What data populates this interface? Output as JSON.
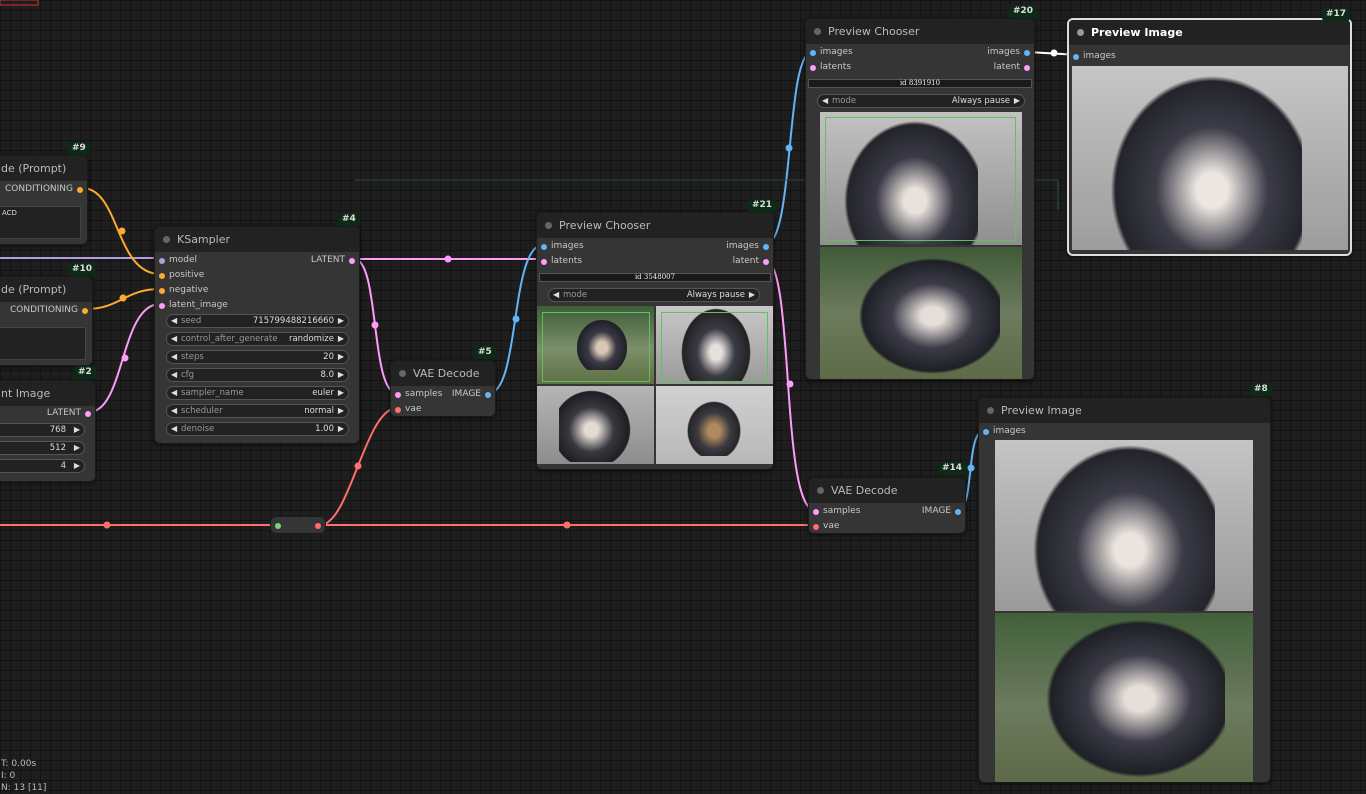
{
  "nodes": {
    "clip_pos": {
      "title": "de (Prompt)",
      "badge": "#9",
      "output": "CONDITIONING",
      "text": "ACD"
    },
    "clip_neg": {
      "title": "de (Prompt)",
      "badge": "#10",
      "output": "CONDITIONING"
    },
    "latent": {
      "title": "nt Image",
      "badge": "#2",
      "output": "LATENT",
      "width": "768",
      "height": "512",
      "batch": "4"
    },
    "ksampler": {
      "title": "KSampler",
      "badge": "#4",
      "inputs": [
        "model",
        "positive",
        "negative",
        "latent_image"
      ],
      "output": "LATENT",
      "widgets": [
        {
          "label": "seed",
          "value": "715799488216660"
        },
        {
          "label": "control_after_generate",
          "value": "randomize"
        },
        {
          "label": "steps",
          "value": "20"
        },
        {
          "label": "cfg",
          "value": "8.0"
        },
        {
          "label": "sampler_name",
          "value": "euler"
        },
        {
          "label": "scheduler",
          "value": "normal"
        },
        {
          "label": "denoise",
          "value": "1.00"
        }
      ]
    },
    "vae5": {
      "title": "VAE Decode",
      "badge": "#5",
      "in1": "samples",
      "in2": "vae",
      "output": "IMAGE"
    },
    "chooser21": {
      "title": "Preview Chooser",
      "badge": "#21",
      "in1": "images",
      "in2": "latents",
      "out1": "images",
      "out2": "latent",
      "id": "id 3548007",
      "mode_label": "mode",
      "mode_value": "Always pause"
    },
    "chooser20": {
      "title": "Preview Chooser",
      "badge": "#20",
      "in1": "images",
      "in2": "latents",
      "out1": "images",
      "out2": "latent",
      "id": "id 8391910",
      "mode_label": "mode",
      "mode_value": "Always pause"
    },
    "preview17": {
      "title": "Preview Image",
      "badge": "#17",
      "in1": "images"
    },
    "vae14": {
      "title": "VAE Decode",
      "badge": "#14",
      "in1": "samples",
      "in2": "vae",
      "output": "IMAGE"
    },
    "preview8": {
      "title": "Preview Image",
      "badge": "#8",
      "in1": "images"
    }
  },
  "hud": {
    "line1": "T: 0.00s",
    "line2": "I: 0",
    "line3": "N: 13 [11]"
  },
  "colors": {
    "model": "#b39ddb",
    "conditioning": "#ffa931",
    "latent": "#ff9cf9",
    "image": "#64b5f6",
    "vae": "#ff6e6e",
    "selection": "#5ec35e"
  },
  "icons": {
    "left_arrow": "◀",
    "right_arrow": "▶"
  }
}
